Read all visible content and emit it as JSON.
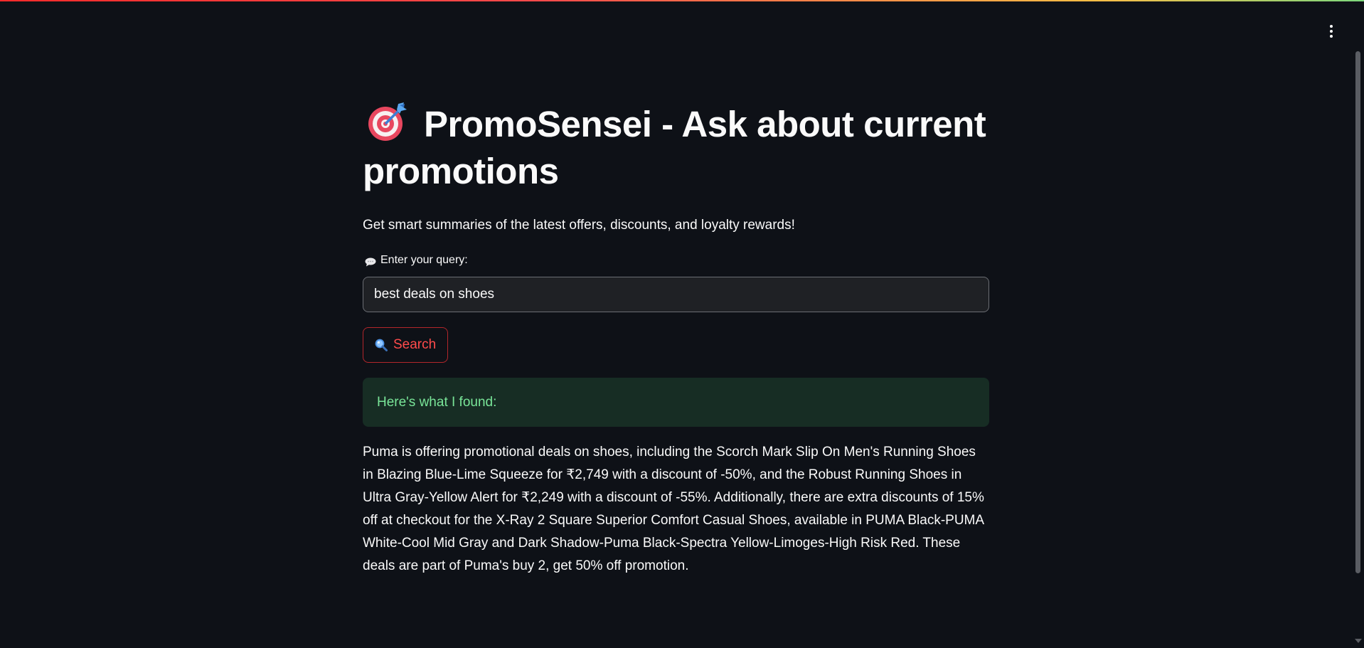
{
  "app": {
    "title": "PromoSensei - Ask about current promotions",
    "subtitle": "Get smart summaries of the latest offers, discounts, and loyalty rewards!"
  },
  "query": {
    "label": "Enter your query:",
    "value": "best deals on shoes",
    "label_icon": "speech-bubble-icon"
  },
  "search_button": {
    "label": "Search",
    "icon": "magnifier-icon"
  },
  "result": {
    "heading": "Here's what I found:",
    "answer": "Puma is offering promotional deals on shoes, including the Scorch Mark Slip On Men's Running Shoes in Blazing Blue-Lime Squeeze for ₹2,749 with a discount of -50%, and the Robust Running Shoes in Ultra Gray-Yellow Alert for ₹2,249 with a discount of -55%. Additionally, there are extra discounts of 15% off at checkout for the X-Ray 2 Square Superior Comfort Casual Shoes, available in PUMA Black-PUMA White-Cool Mid Gray and Dark Shadow-Puma Black-Spectra Yellow-Limoges-High Risk Red. These deals are part of Puma's buy 2, get 50% off promotion."
  },
  "colors": {
    "background": "#0e1117",
    "accent": "#ff4b4b",
    "success_bg": "#172d24",
    "success_text": "#79e598"
  },
  "icons": {
    "title": "direct-hit-target-icon",
    "menu": "vertical-dots-menu-icon"
  }
}
